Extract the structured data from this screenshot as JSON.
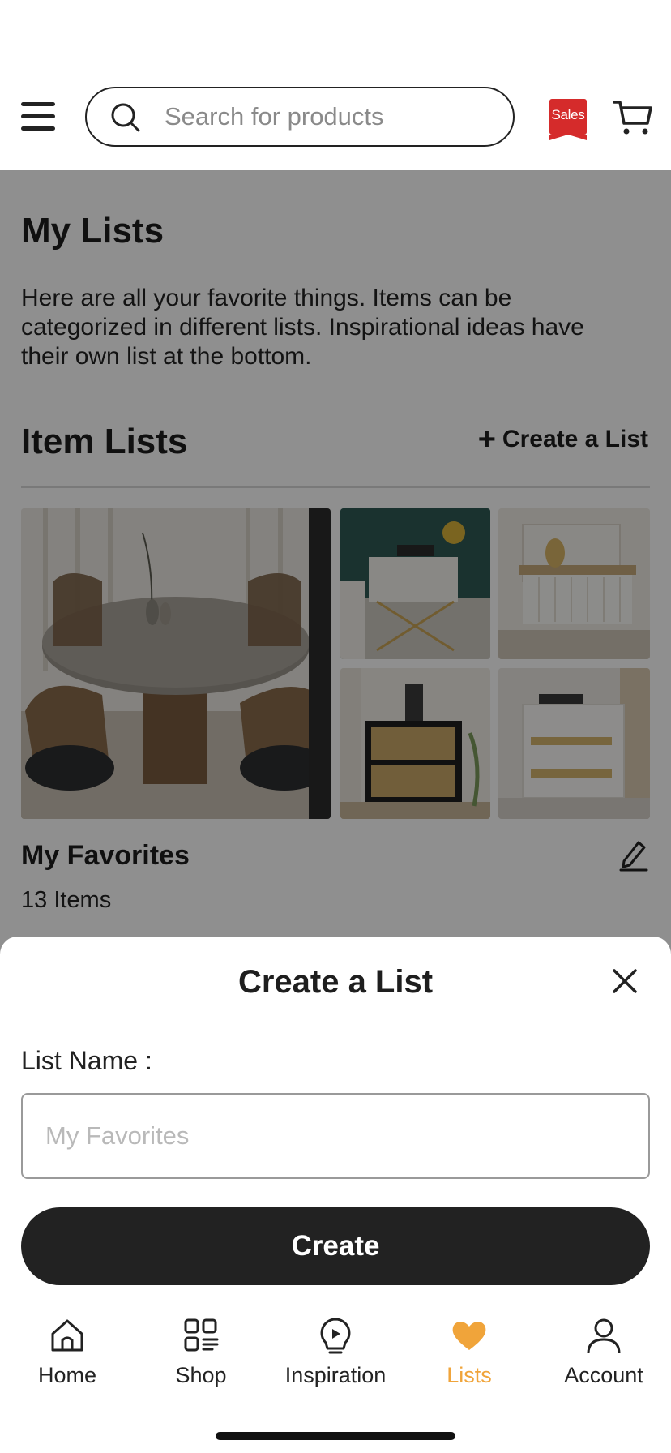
{
  "header": {
    "search_placeholder": "Search for products",
    "sales_badge": "Sales",
    "sales_color": "#d52b2b"
  },
  "page": {
    "title": "My Lists",
    "description": "Here are all your favorite things. Items can be categorized in different lists. Inspirational ideas have their own list at the bottom."
  },
  "item_lists": {
    "title": "Item Lists",
    "create_link": "Create a List",
    "lists": [
      {
        "name": "My Favorites",
        "count": "13 Items"
      }
    ]
  },
  "modal": {
    "title": "Create a List",
    "field_label": "List Name :",
    "input_placeholder": "My Favorites",
    "input_value": "",
    "submit_label": "Create"
  },
  "tabbar": {
    "active_color": "#f0a43a",
    "tabs": [
      {
        "label": "Home",
        "icon": "home-icon"
      },
      {
        "label": "Shop",
        "icon": "grid-icon"
      },
      {
        "label": "Inspiration",
        "icon": "bulb-icon"
      },
      {
        "label": "Lists",
        "icon": "heart-icon",
        "active": true
      },
      {
        "label": "Account",
        "icon": "person-icon"
      }
    ]
  }
}
